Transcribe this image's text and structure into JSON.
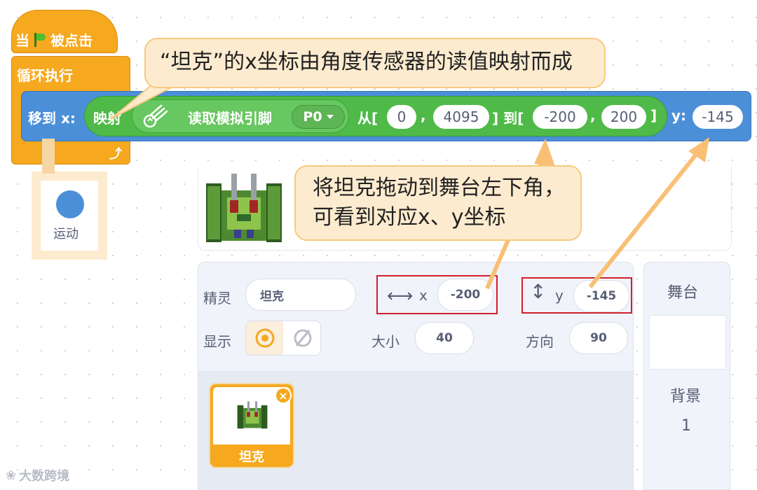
{
  "blocks": {
    "when_flag": {
      "label_before": "当",
      "label_after": "被点击"
    },
    "forever": {
      "label": "循环执行"
    },
    "goto": {
      "label_x": "移到 x:",
      "label_y": "y:",
      "y_value": "-145"
    },
    "map": {
      "label": "映射",
      "sensor_label": "读取模拟引脚",
      "pin": "P0",
      "from_open": "从[",
      "from_min": "0",
      "sep": ",",
      "from_max": "4095",
      "to_open": "] 到[",
      "to_min": "-200",
      "to_max": "200",
      "close": "]"
    }
  },
  "callouts": {
    "top": "“坦克”的x坐标由角度传感器的读值映射而成",
    "middle_line1": "将坦克拖动到舞台左下角，",
    "middle_line2": "可看到对应x、y坐标"
  },
  "category": {
    "label": "运动",
    "color": "#4b8fd8"
  },
  "sprite_info": {
    "sprite_label": "精灵",
    "sprite_name": "坦克",
    "x_label": "x",
    "x_value": "-200",
    "y_label": "y",
    "y_value": "-145",
    "show_label": "显示",
    "size_label": "大小",
    "size_value": "40",
    "direction_label": "方向",
    "direction_value": "90"
  },
  "sprite_list": [
    {
      "name": "坦克"
    }
  ],
  "stage": {
    "label": "舞台",
    "backdrops_label": "背景",
    "backdrops_count": "1"
  },
  "watermark": "大数跨境",
  "colors": {
    "events": "#f6a81e",
    "motion": "#4b8fd8",
    "operators": "#4fba48",
    "callout": "#fdebcf",
    "highlight": "#d01f2b"
  }
}
